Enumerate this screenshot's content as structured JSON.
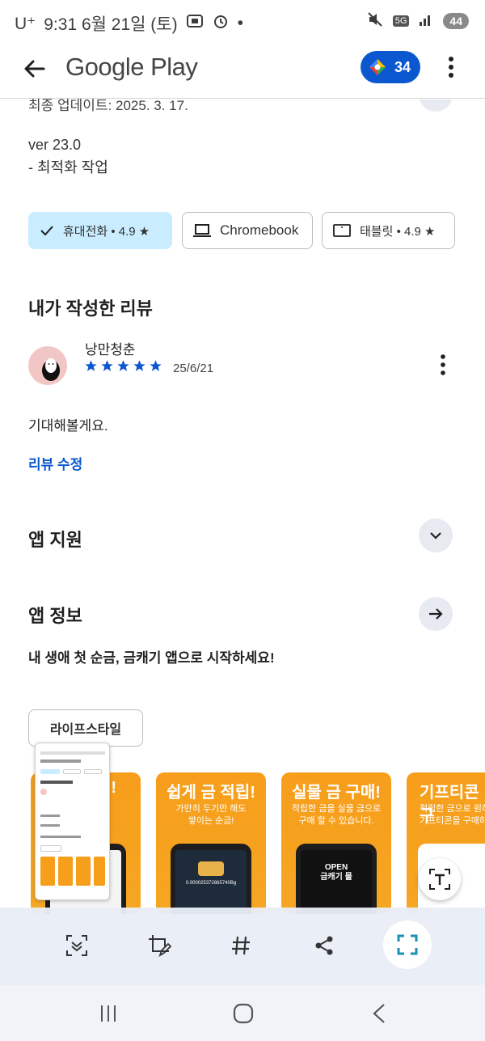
{
  "status_bar": {
    "carrier": "U⁺",
    "time_date": "9:31 6월 21일 (토)",
    "network": "5G",
    "battery": "44"
  },
  "top_bar": {
    "title": "Google Play",
    "points": "34"
  },
  "whats_new": {
    "last_updated": "최종 업데이트: 2025. 3. 17.",
    "version": "ver 23.0",
    "note": "- 최적화 작업"
  },
  "device_chips": [
    {
      "label": "휴대전화 • 4.9 ★",
      "selected": true
    },
    {
      "label": "Chromebook",
      "selected": false
    },
    {
      "label": "태블릿 • 4.9 ★",
      "selected": false
    }
  ],
  "my_review": {
    "title": "내가 작성한 리뷰",
    "reviewer": "낭만청춘",
    "rating": 5,
    "date": "25/6/21",
    "text": "기대해볼게요.",
    "edit_label": "리뷰 수정"
  },
  "app_support": {
    "title": "앱 지원"
  },
  "app_info": {
    "title": "앱 정보",
    "description": "내 생애 첫 순금, 금캐기 앱으로 시작하세요!",
    "category": "라이프스타일"
  },
  "screenshots": [
    {
      "heading": "!",
      "sub": ""
    },
    {
      "heading": "쉽게 금 적립!",
      "sub": "가만히 두기만 해도\n쌓이는 순금!",
      "screen_value": "0.000025372865740Bg"
    },
    {
      "heading": "실물 금 구매!",
      "sub": "적립한 금을 실물 금으로\n구매 할 수 있습니다.",
      "screen_title": "OPEN\n금캐기 몰"
    },
    {
      "heading": "기프티콘 구",
      "sub": "적립한 금으로 원하\n기프티콘을 구매하"
    }
  ],
  "colors": {
    "accent_blue": "#0b57d0",
    "selected_chip": "#c9ecff",
    "card_orange": "#f79e1b",
    "star_blue": "#0b57d0"
  }
}
